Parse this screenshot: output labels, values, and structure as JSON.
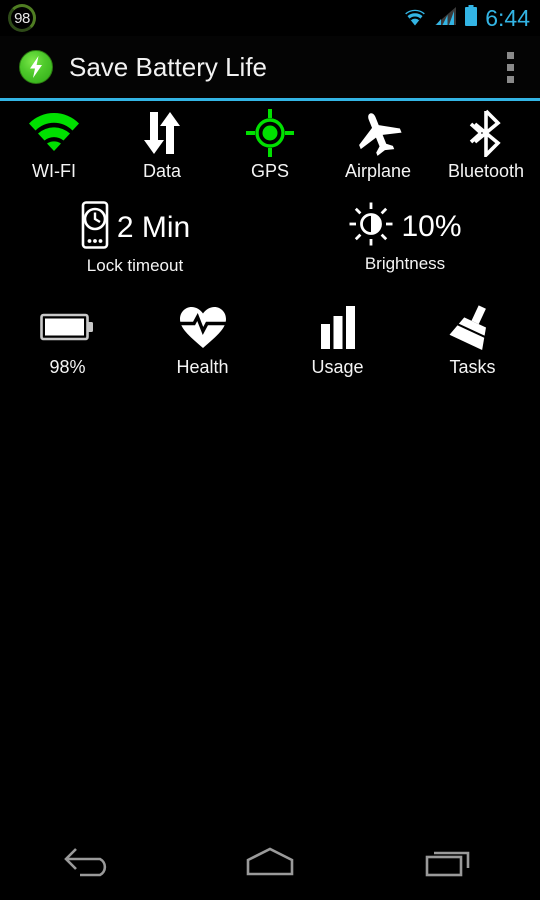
{
  "status_bar": {
    "battery_badge": "98",
    "clock": "6:44",
    "icons": [
      "wifi-signal-icon",
      "cellular-signal-icon",
      "battery-icon"
    ],
    "accent_color": "#33b5e5"
  },
  "action_bar": {
    "title": "Save Battery Life",
    "logo_icon": "lightning-bolt-logo",
    "overflow_icon": "overflow-menu-icon",
    "accent_color": "#33b5e5",
    "logo_color": "#4ec92b"
  },
  "toggles": [
    {
      "label": "WI-FI",
      "icon": "wifi-icon",
      "state": "on",
      "color": "#00e000"
    },
    {
      "label": "Data",
      "icon": "data-sync-icon",
      "state": "off",
      "color": "#ffffff"
    },
    {
      "label": "GPS",
      "icon": "gps-icon",
      "state": "on",
      "color": "#00e000"
    },
    {
      "label": "Airplane",
      "icon": "airplane-icon",
      "state": "off",
      "color": "#ffffff"
    },
    {
      "label": "Bluetooth",
      "icon": "bluetooth-icon",
      "state": "off",
      "color": "#ffffff"
    }
  ],
  "stats": [
    {
      "value": "2 Min",
      "label": "Lock timeout",
      "icon": "phone-clock-icon"
    },
    {
      "value": "10%",
      "label": "Brightness",
      "icon": "brightness-sun-icon"
    }
  ],
  "shortcuts": [
    {
      "label": "98%",
      "icon": "battery-level-icon"
    },
    {
      "label": "Health",
      "icon": "heart-pulse-icon"
    },
    {
      "label": "Usage",
      "icon": "bar-chart-icon"
    },
    {
      "label": "Tasks",
      "icon": "broom-icon"
    }
  ],
  "nav_bar": {
    "back_icon": "back-arrow-icon",
    "home_icon": "home-icon",
    "recents_icon": "recent-apps-icon",
    "color": "#9a9a9a"
  }
}
